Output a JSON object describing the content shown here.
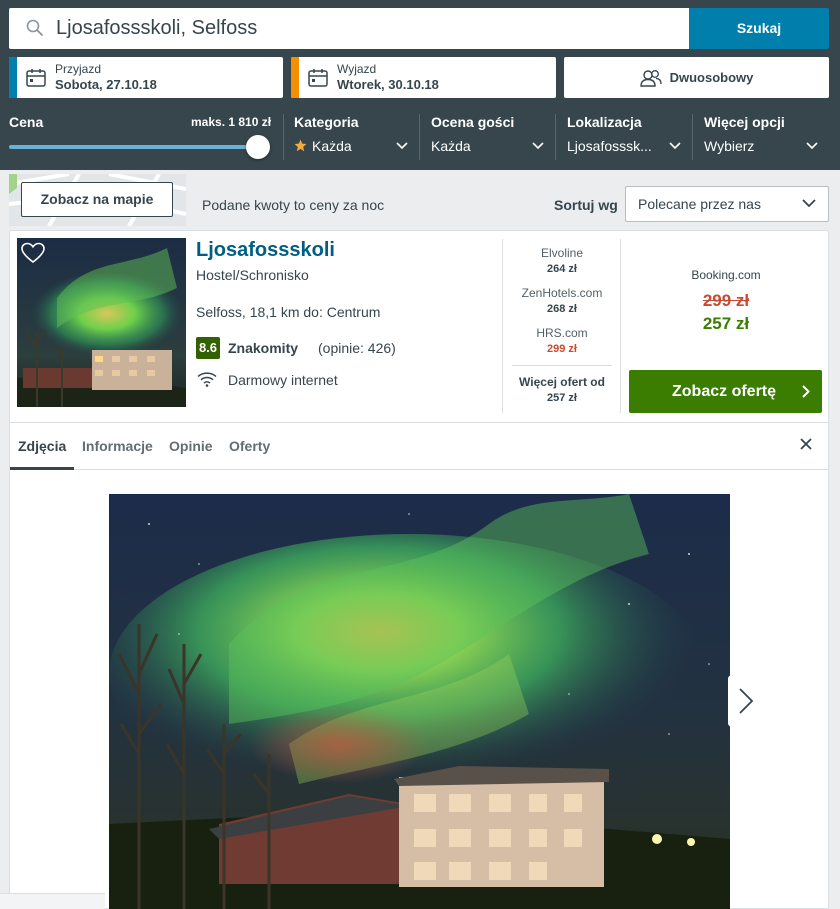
{
  "search": {
    "value": "Ljosafossskoli, Selfoss",
    "button_label": "Szukaj"
  },
  "dates": {
    "checkin_label": "Przyjazd",
    "checkin_value": "Sobota, 27.10.18",
    "checkout_label": "Wyjazd",
    "checkout_value": "Wtorek, 30.10.18"
  },
  "room": {
    "label": "Dwuosobowy"
  },
  "filters": {
    "price_title": "Cena",
    "price_max": "maks. 1 810 zł",
    "price_slider_fraction": 1.0,
    "category_title": "Kategoria",
    "category_value": "Każda",
    "rating_title": "Ocena gości",
    "rating_value": "Każda",
    "location_title": "Lokalizacja",
    "location_value": "Ljosafosssk...",
    "more_title": "Więcej opcji",
    "more_value": "Wybierz"
  },
  "toolbar": {
    "map_button": "Zobacz na mapie",
    "price_note": "Podane kwoty to ceny za noc",
    "sort_label": "Sortuj wg",
    "sort_value": "Polecane przez nas"
  },
  "hotel": {
    "name": "Ljosafossskoli",
    "type": "Hostel/Schronisko",
    "location": "Selfoss, 18,1 km do: Centrum",
    "rating_score": "8.6",
    "rating_label": "Znakomity",
    "rating_count": "(opinie: 426)",
    "amenity": "Darmowy internet"
  },
  "offers": [
    {
      "site": "Elvoline",
      "price": "264 zł"
    },
    {
      "site": "ZenHotels.com",
      "price": "268 zł"
    },
    {
      "site": "HRS.com",
      "price": "299 zł"
    }
  ],
  "more_offers": {
    "label": "Więcej ofert od",
    "price": "257 zł"
  },
  "best_offer": {
    "site": "Booking.com",
    "old_price": "299 zł",
    "price": "257 zł",
    "button_label": "Zobacz ofertę"
  },
  "tabs": [
    {
      "label": "Zdjęcia",
      "active": true
    },
    {
      "label": "Informacje",
      "active": false
    },
    {
      "label": "Opinie",
      "active": false
    },
    {
      "label": "Oferty",
      "active": false
    }
  ],
  "colors": {
    "header_bg": "#37454d",
    "search_button": "#007fad",
    "checkin_accent": "#007fad",
    "checkout_accent": "#f48f00",
    "cta_green": "#3a7d00",
    "rating_green": "#316100",
    "strike_red": "#c94a30",
    "link_blue": "#005e84"
  },
  "icons": {
    "search": "search-icon",
    "calendar": "calendar-icon",
    "guests": "guests-icon",
    "star": "star-icon",
    "chevron": "chevron-down-icon",
    "heart": "heart-icon",
    "wifi": "wifi-icon",
    "close": "close-icon",
    "next": "chevron-right-icon"
  }
}
